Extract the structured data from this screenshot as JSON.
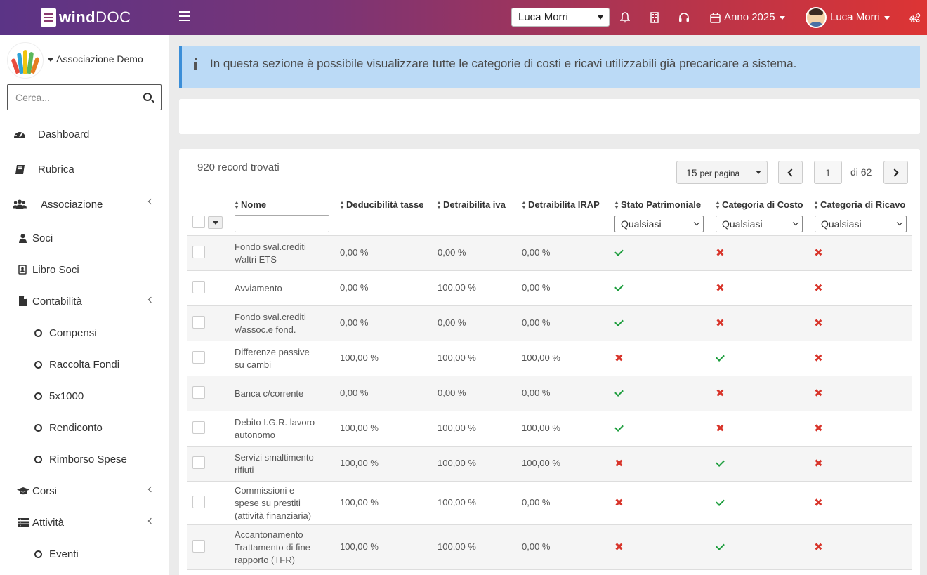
{
  "topbar": {
    "logo_bold": "wind",
    "logo_light": "DOC",
    "user_select_value": "Luca Morri",
    "year_label": "Anno 2025",
    "user_name": "Luca Morri",
    "icons": [
      "menu-icon",
      "bell-icon",
      "building-icon",
      "headset-icon",
      "calendar-icon",
      "cogs-icon"
    ]
  },
  "sidebar": {
    "org_name": "Associazione Demo",
    "search_placeholder": "Cerca...",
    "items": [
      {
        "label": "Dashboard",
        "icon": "tachometer-icon"
      },
      {
        "label": "Rubrica",
        "icon": "book-icon"
      },
      {
        "label": "Associazione",
        "icon": "users-icon"
      },
      {
        "label": "Soci",
        "icon": "user-icon"
      },
      {
        "label": "Libro Soci",
        "icon": "address-book-icon"
      },
      {
        "label": "Contabilità",
        "icon": "file-icon"
      },
      {
        "label": "Compensi",
        "icon": "circle-icon"
      },
      {
        "label": "Raccolta Fondi",
        "icon": "circle-icon"
      },
      {
        "label": "5x1000",
        "icon": "circle-icon"
      },
      {
        "label": "Rendiconto",
        "icon": "circle-icon"
      },
      {
        "label": "Rimborso Spese",
        "icon": "circle-icon"
      },
      {
        "label": "Corsi",
        "icon": "graduation-cap-icon"
      },
      {
        "label": "Attività",
        "icon": "list-icon"
      },
      {
        "label": "Eventi",
        "icon": "circle-icon"
      }
    ]
  },
  "info": {
    "text": "In questa sezione è possibile visualizzare tutte le categorie di costi e ricavi utilizzabili già precaricare a sistema."
  },
  "table": {
    "records_found": "920 record trovati",
    "per_page": "15",
    "per_page_suffix": "per pagina",
    "current_page": "1",
    "total_pages": "di 62",
    "columns": {
      "nome": "Nome",
      "deducibilita": "Deducibilità tasse",
      "detraibilita_iva": "Detraibilita iva",
      "detraibilita_irap": "Detraibilita IRAP",
      "stato_patrimoniale": "Stato Patrimoniale",
      "categoria_costo": "Categoria di Costo",
      "categoria_ricavo": "Categoria di Ricavo"
    },
    "filter_any": "Qualsiasi",
    "rows": [
      {
        "nome": "Fondo sval.crediti v/altri ETS",
        "ded": "0,00 %",
        "iva": "0,00 %",
        "irap": "0,00 %",
        "sp": true,
        "costo": false,
        "ricavo": false
      },
      {
        "nome": "Avviamento",
        "ded": "0,00 %",
        "iva": "100,00 %",
        "irap": "0,00 %",
        "sp": true,
        "costo": false,
        "ricavo": false
      },
      {
        "nome": "Fondo sval.crediti v/assoc.e fond.",
        "ded": "0,00 %",
        "iva": "0,00 %",
        "irap": "0,00 %",
        "sp": true,
        "costo": false,
        "ricavo": false
      },
      {
        "nome": "Differenze passive su cambi",
        "ded": "100,00 %",
        "iva": "100,00 %",
        "irap": "100,00 %",
        "sp": false,
        "costo": true,
        "ricavo": false
      },
      {
        "nome": "Banca c/corrente",
        "ded": "0,00 %",
        "iva": "0,00 %",
        "irap": "0,00 %",
        "sp": true,
        "costo": false,
        "ricavo": false
      },
      {
        "nome": "Debito I.G.R. lavoro autonomo",
        "ded": "100,00 %",
        "iva": "100,00 %",
        "irap": "100,00 %",
        "sp": true,
        "costo": false,
        "ricavo": false
      },
      {
        "nome": "Servizi smaltimento rifiuti",
        "ded": "100,00 %",
        "iva": "100,00 %",
        "irap": "100,00 %",
        "sp": false,
        "costo": true,
        "ricavo": false
      },
      {
        "nome": "Commissioni e spese su prestiti (attività finanziaria)",
        "ded": "100,00 %",
        "iva": "100,00 %",
        "irap": "0,00 %",
        "sp": false,
        "costo": true,
        "ricavo": false
      },
      {
        "nome": "Accantonamento Trattamento di fine rapporto (TFR)",
        "ded": "100,00 %",
        "iva": "100,00 %",
        "irap": "0,00 %",
        "sp": false,
        "costo": true,
        "ricavo": false
      }
    ]
  },
  "colors": {
    "topbar_start": "#5b3486",
    "topbar_end": "#dd3434",
    "info_bg": "#bbdaf6",
    "info_border": "#3b8ed8",
    "check_green": "#1e9e3e",
    "cross_red": "#d8342a"
  }
}
